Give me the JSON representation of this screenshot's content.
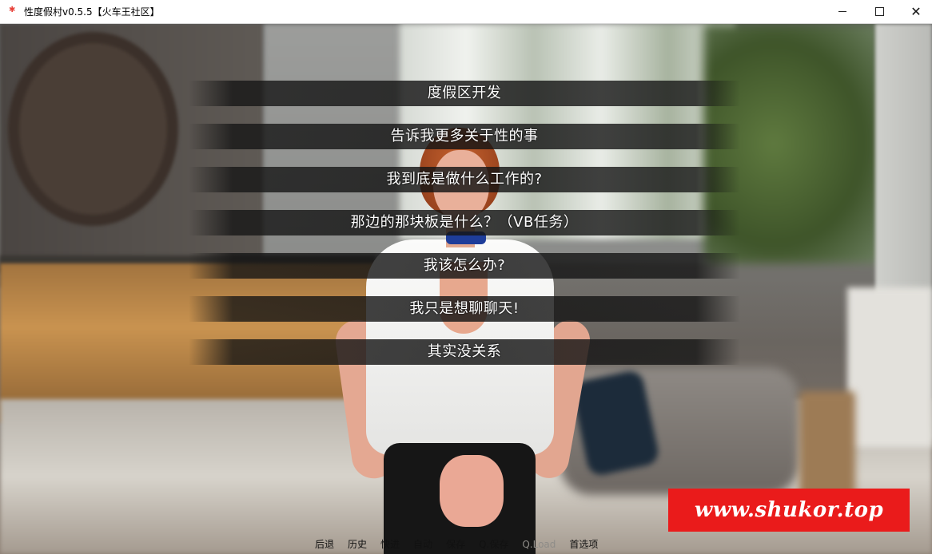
{
  "window": {
    "title": "性度假村v0.5.5【火车王社区】",
    "controls": {
      "minimize_icon": "minimize-icon",
      "maximize_icon": "maximize-icon",
      "close_icon": "close-icon"
    }
  },
  "dialogue": {
    "choices": [
      "度假区开发",
      "告诉我更多关于性的事",
      "我到底是做什么工作的?",
      "那边的那块板是什么？（VB任务）",
      "我该怎么办?",
      "我只是想聊聊天!",
      "其实没关系"
    ]
  },
  "quick_menu": {
    "items": [
      {
        "label": "后退"
      },
      {
        "label": "历史"
      },
      {
        "label": "快进"
      },
      {
        "label": "自动"
      },
      {
        "label": "保存"
      },
      {
        "label": "Q.保存"
      },
      {
        "label": "Q.Load",
        "dim": true
      },
      {
        "label": "首选项"
      }
    ]
  },
  "watermark": {
    "text": "www.shukor.top",
    "color": "#ea1b1b"
  }
}
